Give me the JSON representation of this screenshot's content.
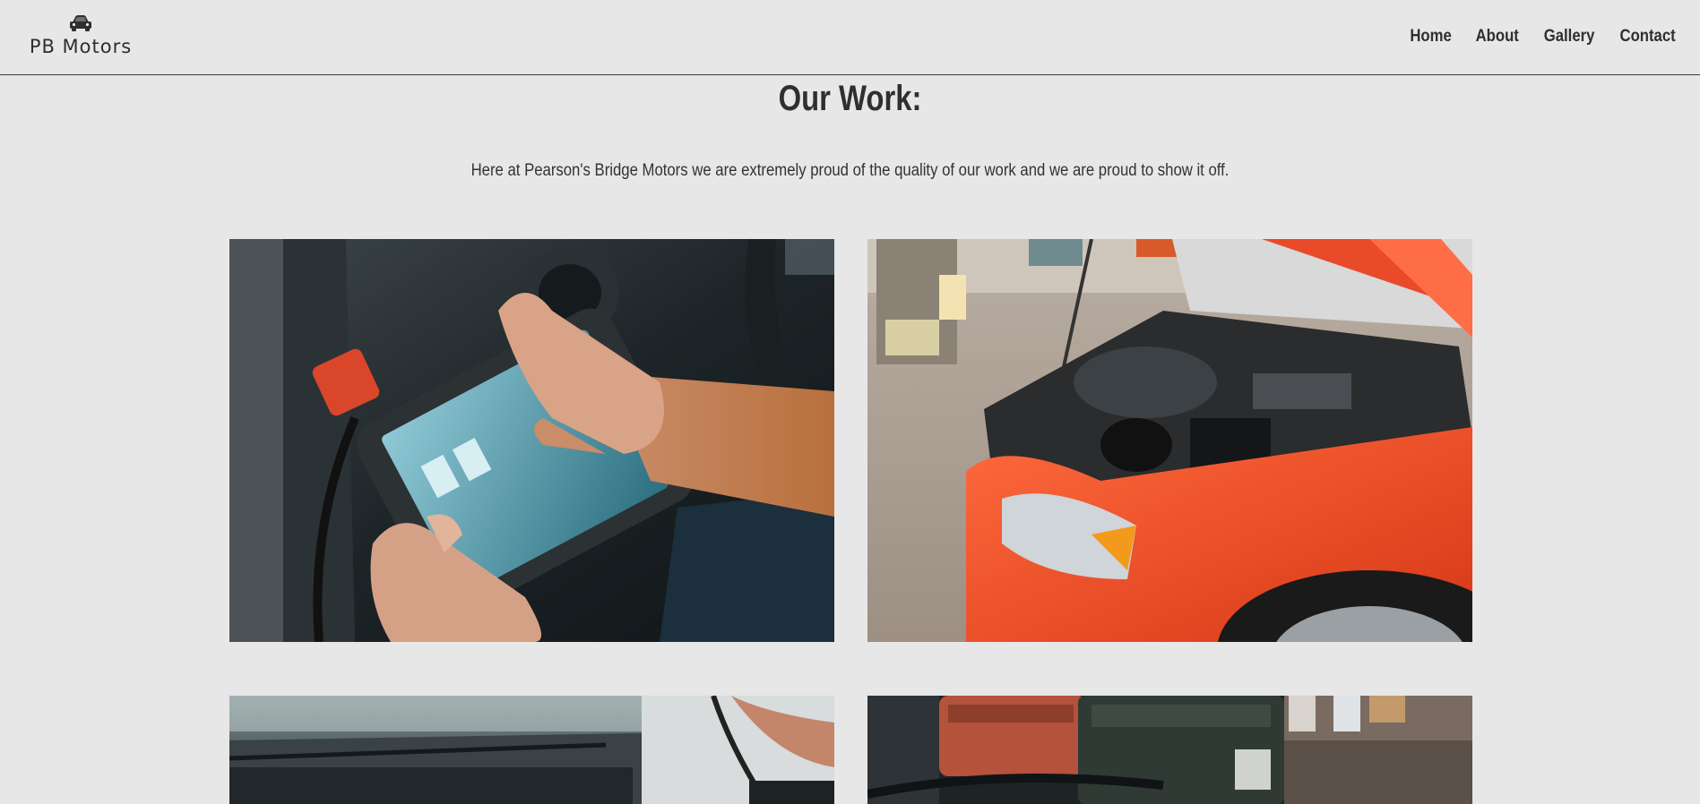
{
  "header": {
    "brand": {
      "icon": "car-icon",
      "name": "PB Motors"
    },
    "nav": {
      "items": [
        {
          "label": "Home"
        },
        {
          "label": "About"
        },
        {
          "label": "Gallery"
        },
        {
          "label": "Contact"
        }
      ]
    }
  },
  "main": {
    "title": "Our Work:",
    "intro": "Here at Pearson's Bridge Motors we are extremely proud of the quality of our work and we are proud to show it off.",
    "gallery": {
      "images": [
        {
          "subject": "mechanic-using-diagnostic-tablet"
        },
        {
          "subject": "orange-car-open-hood"
        },
        {
          "subject": "engine-bay-work"
        },
        {
          "subject": "workshop-toolboxes"
        }
      ]
    }
  },
  "colors": {
    "background": "#e7e7e7",
    "text": "#2f2f2f",
    "divider": "#3a3a3a"
  }
}
